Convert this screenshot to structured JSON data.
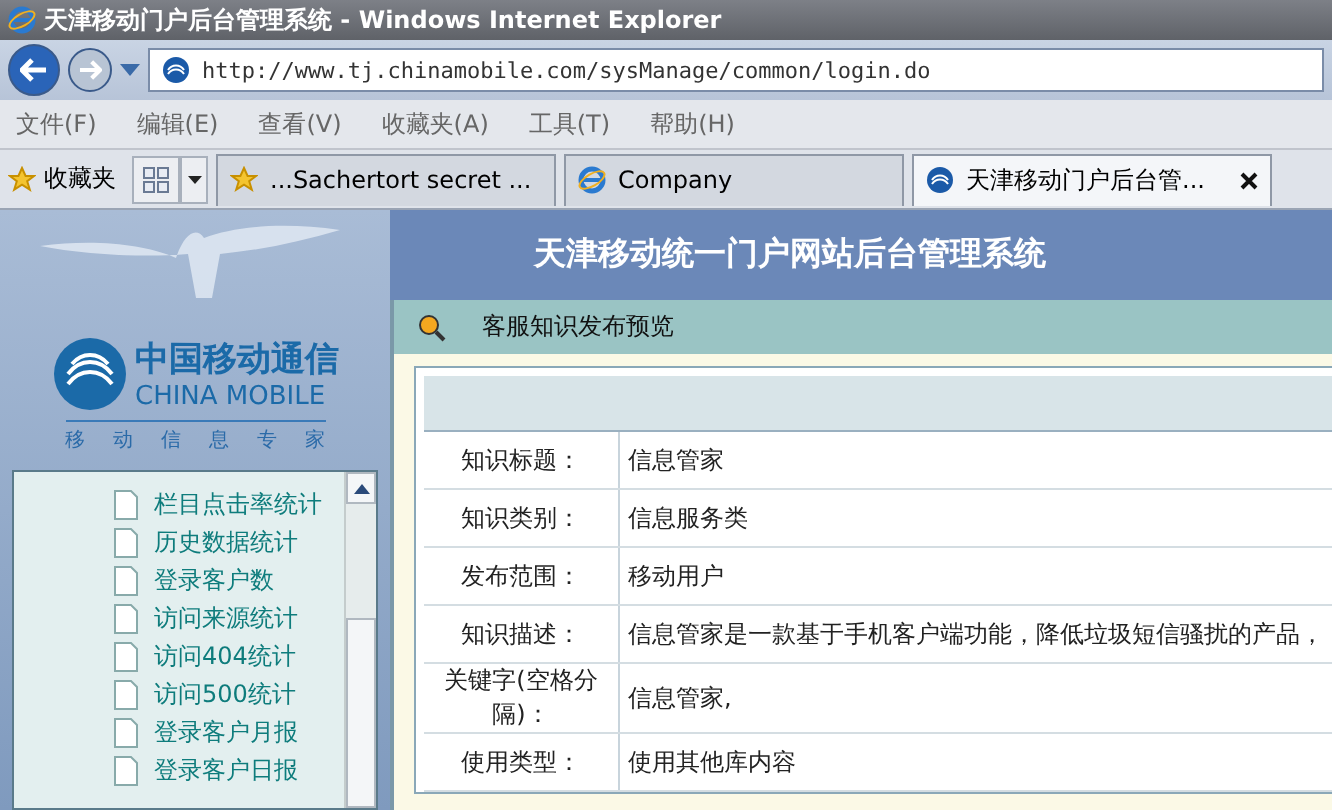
{
  "window": {
    "title": "天津移动门户后台管理系统 - Windows Internet Explorer"
  },
  "address": {
    "value": "http://www.tj.chinamobile.com/sysManage/common/login.do"
  },
  "menu": [
    "文件(F)",
    "编辑(E)",
    "查看(V)",
    "收藏夹(A)",
    "工具(T)",
    "帮助(H)"
  ],
  "favorites": {
    "label": "收藏夹"
  },
  "tabs": [
    {
      "label": "...Sachertort secret ...",
      "kind": "star",
      "selected": false
    },
    {
      "label": "Company",
      "kind": "ie",
      "selected": false
    },
    {
      "label": "天津移动门户后台管...",
      "kind": "site",
      "selected": true
    }
  ],
  "logo": {
    "name": "中国移动通信",
    "latin": "CHINA MOBILE",
    "slogan": [
      "移",
      "动",
      "信",
      "息",
      "专",
      "家"
    ]
  },
  "tree": [
    "栏目点击率统计",
    "历史数据统计",
    "登录客户数",
    "访问来源统计",
    "访问404统计",
    "访问500统计",
    "登录客户月报",
    "登录客户日报"
  ],
  "header": {
    "title": "天津移动统一门户网站后台管理系统"
  },
  "panel": {
    "title": "客服知识发布预览"
  },
  "details": [
    {
      "label": "知识标题：",
      "value": "信息管家"
    },
    {
      "label": "知识类别：",
      "value": "信息服务类"
    },
    {
      "label": "发布范围：",
      "value": "移动用户"
    },
    {
      "label": "知识描述：",
      "value": "信息管家是一款基于手机客户端功能，降低垃圾短信骚扰的产品，"
    },
    {
      "label": "关键字(空格分隔)：",
      "value": "信息管家,"
    },
    {
      "label": "使用类型：",
      "value": "使用其他库内容"
    }
  ]
}
